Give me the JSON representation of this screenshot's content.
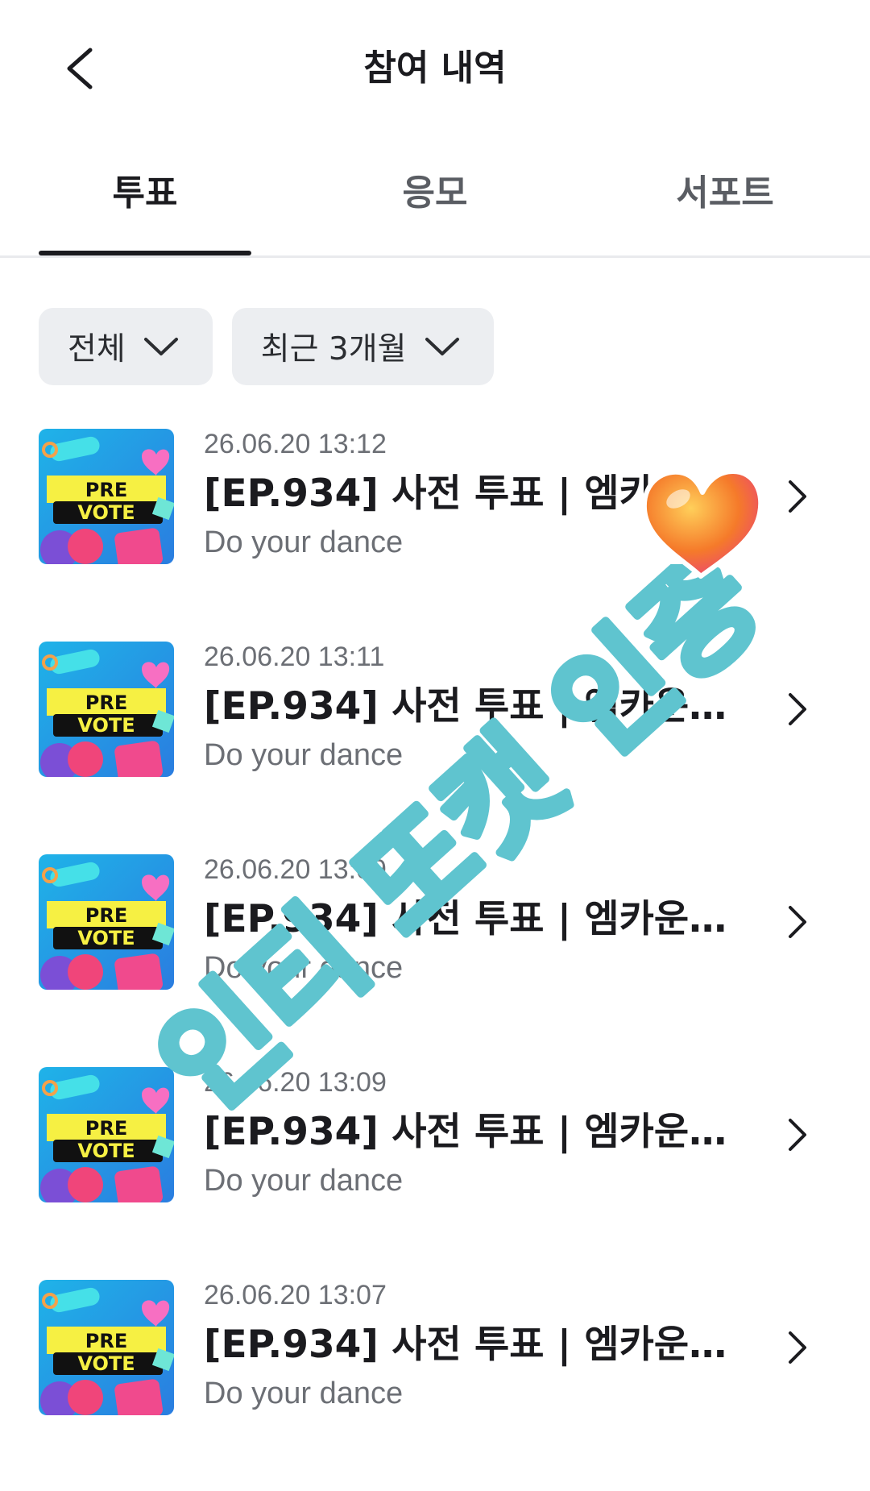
{
  "header": {
    "title": "참여 내역"
  },
  "tabs": [
    {
      "label": "투표",
      "active": true
    },
    {
      "label": "응모",
      "active": false
    },
    {
      "label": "서포트",
      "active": false
    }
  ],
  "filters": {
    "type": {
      "label": "전체"
    },
    "period": {
      "label": "최근 3개월"
    }
  },
  "thumbnail": {
    "line1": "PRE",
    "line2": "VOTE"
  },
  "items": [
    {
      "date": "26.06.20 13:12",
      "title": "[EP.934] 사전 투표 | 엠카운트다...",
      "subtitle": "Do your dance"
    },
    {
      "date": "26.06.20 13:11",
      "title": "[EP.934] 사전 투표 | 엠카운트다...",
      "subtitle": "Do your dance"
    },
    {
      "date": "26.06.20 13:09",
      "title": "[EP.934] 사전 투표 | 엠카운트다...",
      "subtitle": "Do your dance"
    },
    {
      "date": "26.06.20 13:09",
      "title": "[EP.934] 사전 투표 | 엠카운트다...",
      "subtitle": "Do your dance"
    },
    {
      "date": "26.06.20 13:07",
      "title": "[EP.934] 사전 투표 | 엠카운트다...",
      "subtitle": "Do your dance"
    }
  ],
  "overlay": {
    "watermark_text": "인티 또캣 인증",
    "heart_color": "#f57a2a",
    "watermark_color": "#5fc4cf"
  },
  "colors": {
    "text_primary": "#1b1b1f",
    "text_secondary": "#6c6f75",
    "chip_bg": "#eceef1"
  }
}
